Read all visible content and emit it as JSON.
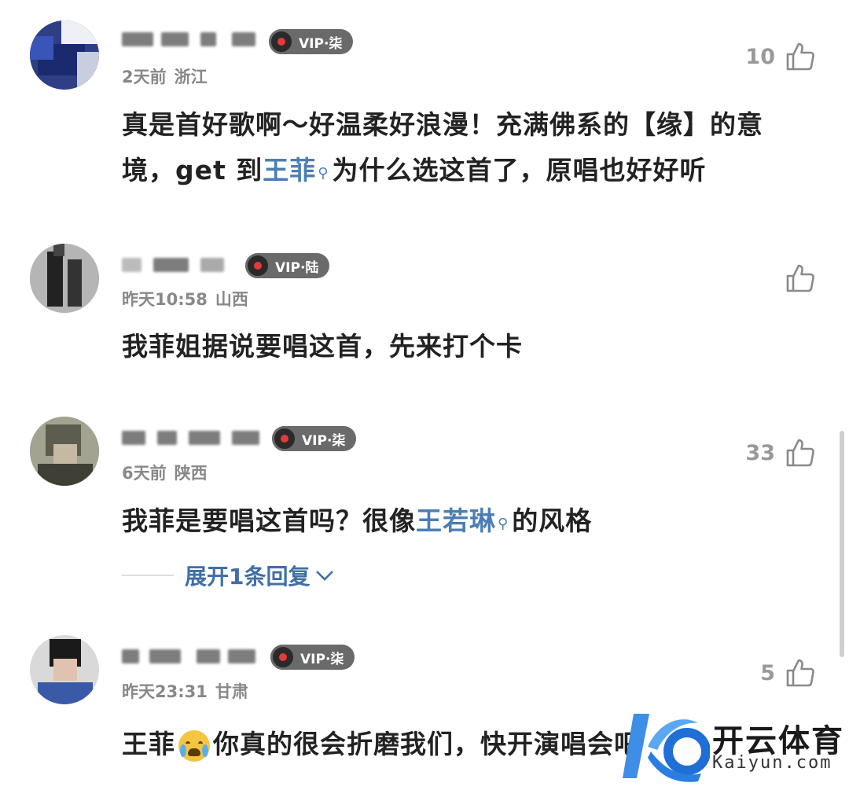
{
  "comments": [
    {
      "vip": "VIP·柒",
      "time": "2天前",
      "location": "浙江",
      "likes": "10",
      "text_parts": [
        "真是首好歌啊～好温柔好浪漫！充满佛系的【缘】的意境，get 到",
        "王菲",
        "为什么选这首了，原唱也好好听"
      ]
    },
    {
      "vip": "VIP·陆",
      "time": "昨天10:58",
      "location": "山西",
      "likes": "",
      "text": "我菲姐据说要唱这首，先来打个卡"
    },
    {
      "vip": "VIP·柒",
      "time": "6天前",
      "location": "陕西",
      "likes": "33",
      "text_parts": [
        "我菲是要唱这首吗？很像",
        "王若琳",
        "的风格"
      ],
      "replies_label": "展开1条回复"
    },
    {
      "vip": "VIP·柒",
      "time": "昨天23:31",
      "location": "甘肃",
      "likes": "5",
      "text_parts": [
        "王菲",
        "你真的很会折磨我们，快开演唱会吧"
      ]
    }
  ],
  "watermark": {
    "title": "开云体育",
    "subtitle": "Kaiyun.com"
  },
  "colors": {
    "link": "#4a7fb5",
    "vip_badge": "#6a6a6a",
    "text": "#222222",
    "meta": "#888888"
  },
  "icons": {
    "like": "thumbs-up-icon",
    "search": "search-icon",
    "expand": "chevron-down-icon",
    "vip": "vinyl-disc-icon",
    "emoji": "crying-face-icon"
  }
}
